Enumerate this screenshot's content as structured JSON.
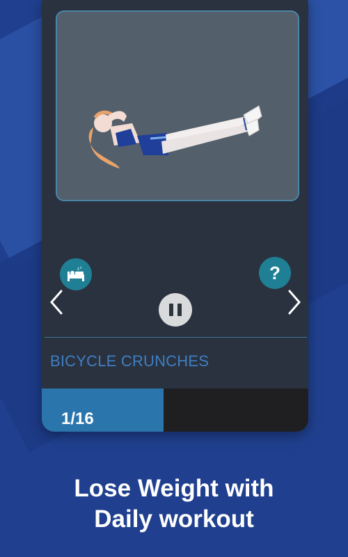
{
  "exercise": {
    "name": "BICYCLE CRUNCHES",
    "video_alt": "woman doing crunches"
  },
  "controls": {
    "rest_icon": "sleep-bed-icon",
    "help_label": "?",
    "pause_icon": "pause-icon",
    "prev_icon": "chevron-left-icon",
    "next_icon": "chevron-right-icon"
  },
  "progress": {
    "current": 1,
    "total": 16,
    "label": "1/16",
    "fraction": 0.457
  },
  "promo": {
    "line1": "Lose Weight with",
    "line2": "Daily workout"
  },
  "colors": {
    "background": "#20408f",
    "card": "#2a3240",
    "accent_teal": "#1f8095",
    "progress_fill": "#2b75ad",
    "exercise_title": "#3f7fc1"
  }
}
